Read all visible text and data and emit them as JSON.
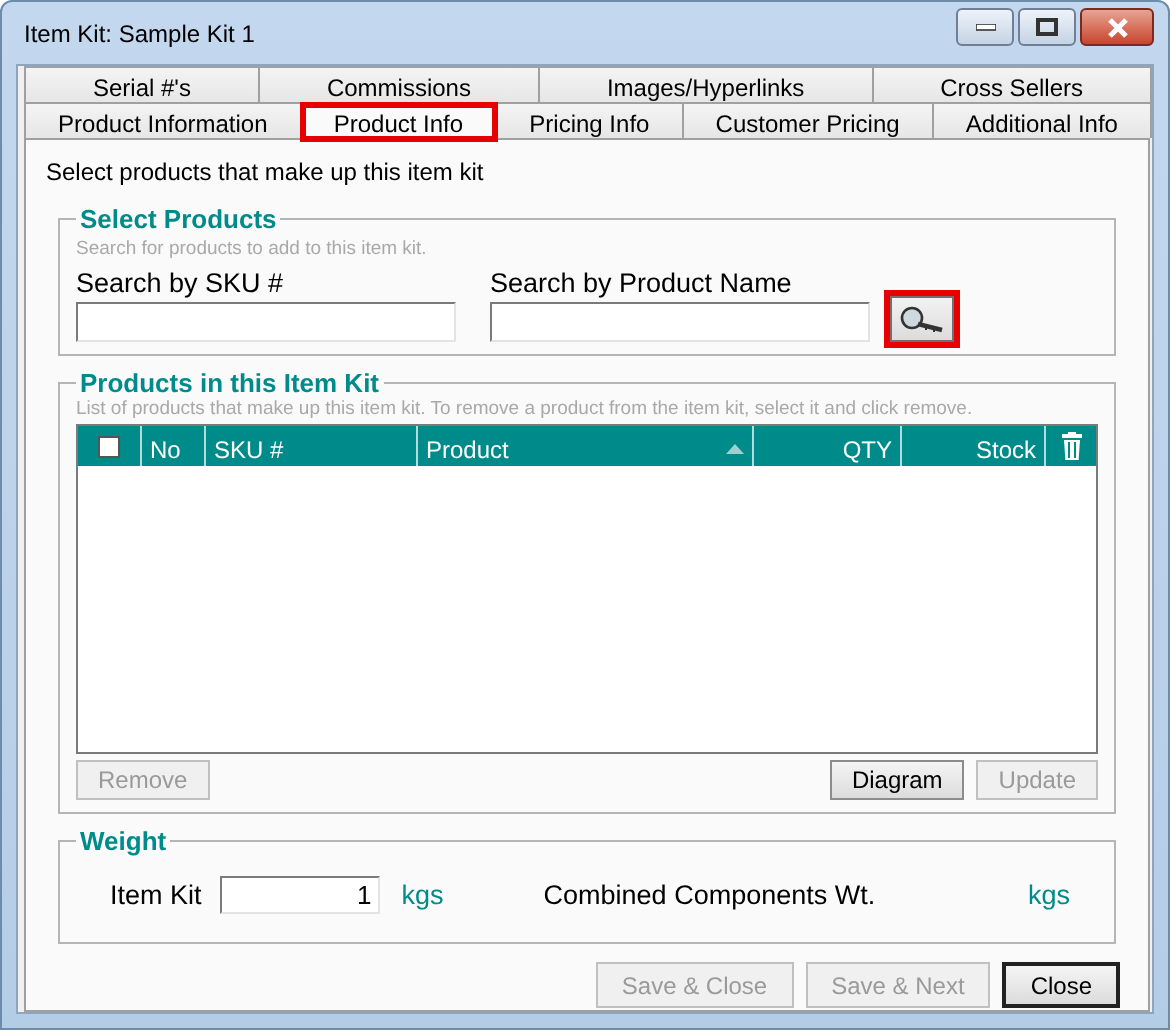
{
  "window": {
    "title": "Item Kit: Sample Kit 1"
  },
  "tab_rows": [
    [
      {
        "label": "Serial #'s",
        "selected": false,
        "highlighted": false
      },
      {
        "label": "Commissions",
        "selected": false,
        "highlighted": false
      },
      {
        "label": "Images/Hyperlinks",
        "selected": false,
        "highlighted": false
      },
      {
        "label": "Cross Sellers",
        "selected": false,
        "highlighted": false
      }
    ],
    [
      {
        "label": "Product Information",
        "selected": false,
        "highlighted": false
      },
      {
        "label": "Product Info",
        "selected": true,
        "highlighted": true
      },
      {
        "label": "Pricing Info",
        "selected": false,
        "highlighted": false
      },
      {
        "label": "Customer Pricing",
        "selected": false,
        "highlighted": false
      },
      {
        "label": "Additional Info",
        "selected": false,
        "highlighted": false
      }
    ]
  ],
  "intro": "Select products that make up this item kit",
  "select_products": {
    "legend": "Select Products",
    "hint": "Search for products to add to this item kit.",
    "fields": [
      {
        "label": "Search by SKU #"
      },
      {
        "label": "Search by Product Name"
      }
    ],
    "search_button": {
      "highlighted": true
    }
  },
  "products": {
    "legend": "Products in this Item Kit",
    "hint": "List of products that make up this item kit. To remove a product from the item kit, select it and click remove.",
    "columns": [
      {
        "kind": "checkbox",
        "checked": false
      },
      {
        "kind": "text",
        "label": "No"
      },
      {
        "kind": "text",
        "label": "SKU #"
      },
      {
        "kind": "text",
        "label": "Product",
        "sorted": true
      },
      {
        "kind": "number",
        "label": "QTY"
      },
      {
        "kind": "number",
        "label": "Stock"
      },
      {
        "kind": "delete"
      }
    ],
    "buttons": [
      {
        "label": "Remove",
        "disabled": true
      },
      {
        "label": "Diagram",
        "disabled": false
      },
      {
        "label": "Update",
        "disabled": true
      }
    ]
  },
  "weight": {
    "legend": "Weight",
    "item_kit_label": "Item Kit",
    "value": "1",
    "unit": "kgs",
    "combined_label": "Combined Components Wt.",
    "combined_unit": "kgs"
  },
  "footer_buttons": [
    {
      "label": "Save & Close",
      "disabled": true,
      "default": false
    },
    {
      "label": "Save & Next",
      "disabled": true,
      "default": false
    },
    {
      "label": "Close",
      "disabled": false,
      "default": true
    }
  ]
}
